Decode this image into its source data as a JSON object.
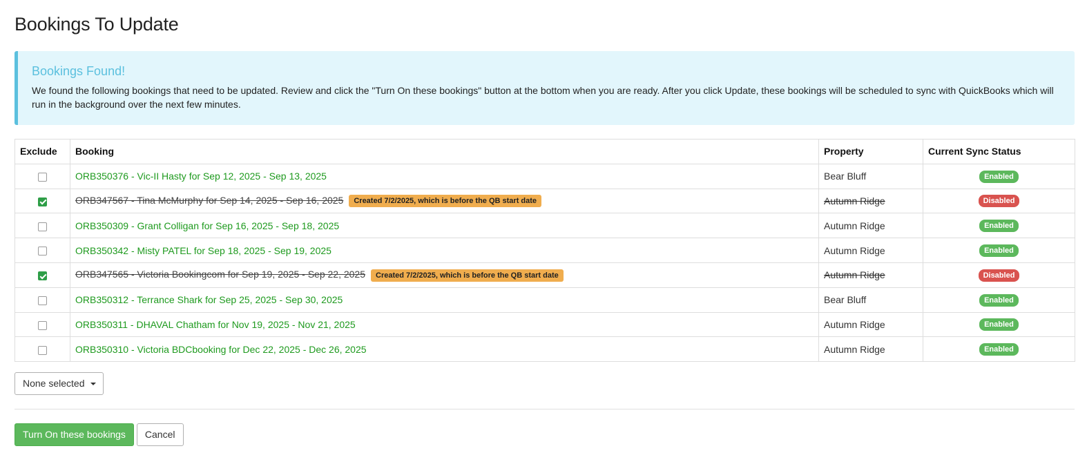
{
  "page_title": "Bookings To Update",
  "alert": {
    "title": "Bookings Found!",
    "text": "We found the following bookings that need to be updated. Review and click the \"Turn On these bookings\" button at the bottom when you are ready. After you click Update, these bookings will be scheduled to sync with QuickBooks which will run in the background over the next few minutes."
  },
  "table": {
    "headers": {
      "exclude": "Exclude",
      "booking": "Booking",
      "property": "Property",
      "status": "Current Sync Status"
    },
    "rows": [
      {
        "excluded": false,
        "booking": "ORB350376 - Vic-II Hasty for Sep 12, 2025 - Sep 13, 2025",
        "warning": "",
        "property": "Bear Bluff",
        "status": "Enabled"
      },
      {
        "excluded": true,
        "booking": "ORB347567 - Tina McMurphy for Sep 14, 2025 - Sep 16, 2025",
        "warning": "Created 7/2/2025, which is before the QB start date",
        "property": "Autumn Ridge",
        "status": "Disabled"
      },
      {
        "excluded": false,
        "booking": "ORB350309 - Grant Colligan for Sep 16, 2025 - Sep 18, 2025",
        "warning": "",
        "property": "Autumn Ridge",
        "status": "Enabled"
      },
      {
        "excluded": false,
        "booking": "ORB350342 - Misty PATEL for Sep 18, 2025 - Sep 19, 2025",
        "warning": "",
        "property": "Autumn Ridge",
        "status": "Enabled"
      },
      {
        "excluded": true,
        "booking": "ORB347565 - Victoria Bookingcom for Sep 19, 2025 - Sep 22, 2025",
        "warning": "Created 7/2/2025, which is before the QB start date",
        "property": "Autumn Ridge",
        "status": "Disabled"
      },
      {
        "excluded": false,
        "booking": "ORB350312 - Terrance Shark for Sep 25, 2025 - Sep 30, 2025",
        "warning": "",
        "property": "Bear Bluff",
        "status": "Enabled"
      },
      {
        "excluded": false,
        "booking": "ORB350311 - DHAVAL Chatham for Nov 19, 2025 - Nov 21, 2025",
        "warning": "",
        "property": "Autumn Ridge",
        "status": "Enabled"
      },
      {
        "excluded": false,
        "booking": "ORB350310 - Victoria BDCbooking for Dec 22, 2025 - Dec 26, 2025",
        "warning": "",
        "property": "Autumn Ridge",
        "status": "Enabled"
      }
    ]
  },
  "multiselect": {
    "label": "None selected",
    "icon": "caret-down-icon"
  },
  "buttons": {
    "primary": "Turn On these bookings",
    "cancel": "Cancel"
  },
  "colors": {
    "link_green": "#1e9a1e",
    "enabled": "#5cb85c",
    "disabled": "#d9534f",
    "warning": "#f0ad4e",
    "info_border": "#5bc0de",
    "info_bg": "#e2f6fc"
  }
}
